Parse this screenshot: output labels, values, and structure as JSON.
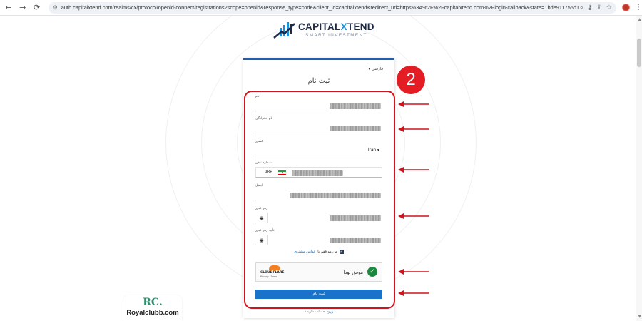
{
  "browser": {
    "url": "auth.capitalxtend.com/realms/cx/protocol/openid-connect/registrations?scope=openid&response_type=code&client_id=capitalxtend&redirect_uri=https%3A%2F%2Fcapitalxtend.com%2Flogin-callback&state=1bde911755d1e55d3fdfb2003f27..."
  },
  "logo": {
    "name_part1": "CAPITAL",
    "name_x": "X",
    "name_part2": "TEND",
    "tagline": "SMART INVESTMENT"
  },
  "form": {
    "language": "فارسی",
    "title": "ثبت نام",
    "fields": {
      "first_name": {
        "label": "نام"
      },
      "last_name": {
        "label": "نام خانوادگی"
      },
      "country": {
        "label": "کشور",
        "value": "Iran"
      },
      "phone": {
        "label": "شماره تلفن",
        "code": "98+"
      },
      "email": {
        "label": "ایمیل"
      },
      "password": {
        "label": "رمز عبور"
      },
      "password_confirm": {
        "label": "تأیید رمز عبور"
      }
    },
    "agree_prefix": "من موافقم با",
    "agree_link": "قوانین مشتری",
    "captcha": {
      "status": "موفق بودا",
      "brand": "CLOUDFLARE",
      "links": "Privacy · Terms"
    },
    "submit_label": "ثبت نام",
    "login_prompt": "حساب دارید؟",
    "login_link": "ورود"
  },
  "annotation": {
    "step_number": "2"
  },
  "watermark": {
    "mark": "RC.",
    "text": "Royalclubb.com"
  },
  "colors": {
    "brand_blue": "#1a73c8",
    "annotation_red": "#d0141d",
    "success_green": "#1c8a3c"
  }
}
